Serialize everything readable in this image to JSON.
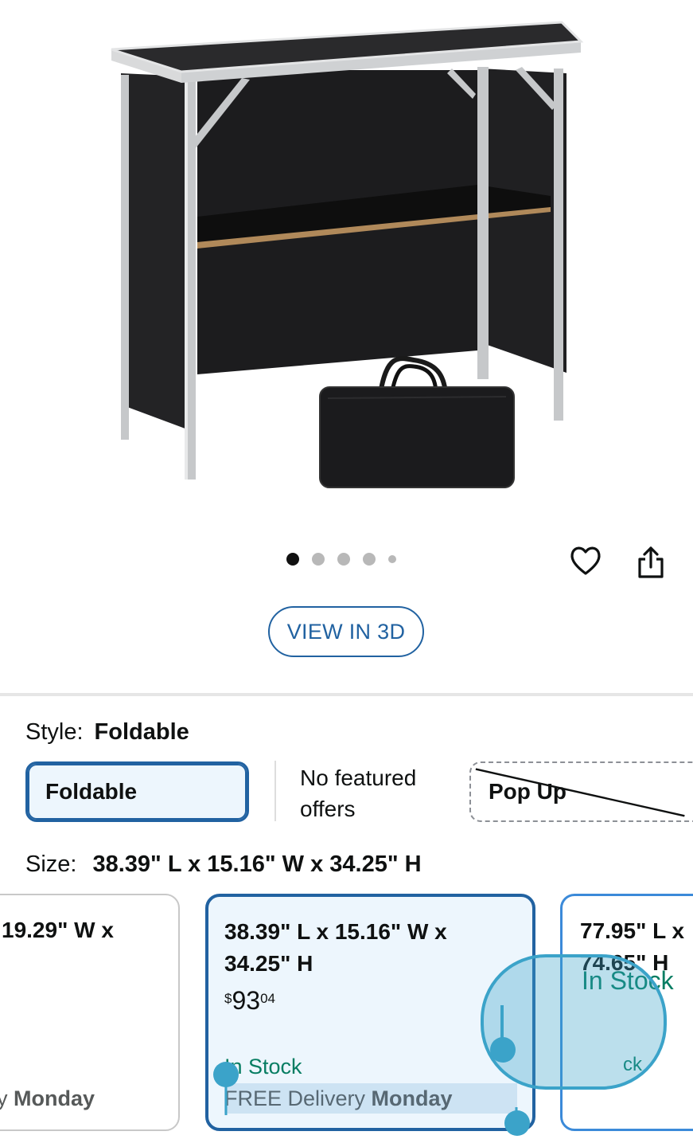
{
  "carousel": {
    "dot_count": 5,
    "active_index": 0
  },
  "actions": {
    "favorite_icon": "heart-icon",
    "share_icon": "share-icon"
  },
  "view_3d": {
    "label": "VIEW IN 3D"
  },
  "style": {
    "label": "Style:",
    "selected_value": "Foldable",
    "options": [
      {
        "label": "Foldable",
        "state": "selected"
      },
      {
        "label": "No featured offers",
        "state": "info"
      },
      {
        "label": "Pop Up",
        "state": "unavailable"
      }
    ],
    "no_offers_line1": "No featured",
    "no_offers_line2": "offers"
  },
  "size": {
    "label": "Size:",
    "selected_value": "38.39\" L x 15.16\" W x 34.25\" H",
    "cards": [
      {
        "title_line1": "19.29\" W x",
        "delivery_day": "Monday",
        "delivery_prefix": "y"
      },
      {
        "title_line1": "38.39\" L x 15.16\" W x",
        "title_line2": "34.25\" H",
        "price_currency": "$",
        "price_whole": "93",
        "price_fraction": "04",
        "stock": "In Stock",
        "delivery_prefix": "FREE Delivery",
        "delivery_day": "Monday"
      },
      {
        "title_line1": "77.95\" L x",
        "title_line2": "74.65\" H",
        "stock": "In Stock",
        "stock_tail": "ck"
      }
    ]
  },
  "colors": {
    "accent": "#2162a1",
    "selected_bg": "#edf6fd",
    "in_stock": "#067d62",
    "secondary_text": "#565959",
    "touch_overlay": "#3ba3c9"
  }
}
